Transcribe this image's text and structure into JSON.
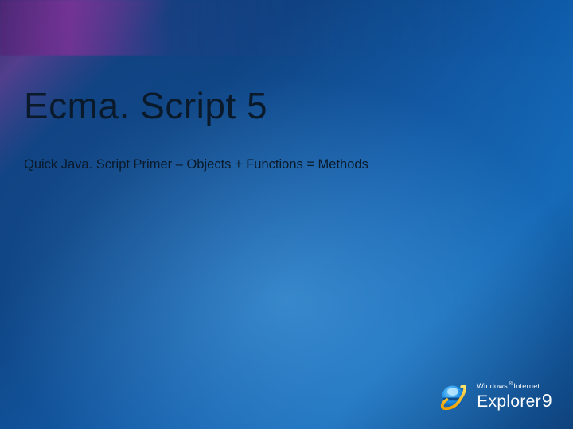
{
  "slide": {
    "title": "Ecma. Script 5",
    "subtitle": "Quick Java. Script Primer – Objects + Functions = Methods"
  },
  "logo": {
    "line1_a": "Windows",
    "reg": "®",
    "line1_b": "Internet",
    "line2": "Explorer",
    "version": "9",
    "icon_name": "internet-explorer-icon"
  }
}
